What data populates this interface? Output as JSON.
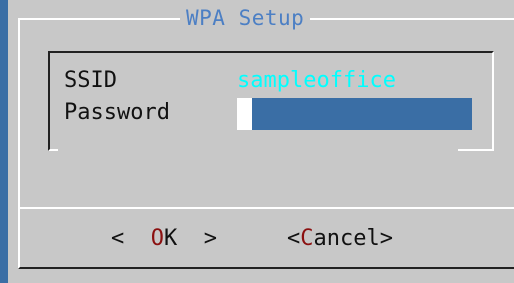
{
  "dialog": {
    "title": "WPA Setup"
  },
  "form": {
    "ssid_label": "SSID",
    "ssid_value": "sampleoffice",
    "password_label": "Password",
    "password_value": ""
  },
  "buttons": {
    "ok": {
      "prefix": "<  ",
      "hotkey": "O",
      "rest": "K  >"
    },
    "cancel": {
      "prefix": "<",
      "hotkey": "C",
      "rest": "ancel>"
    }
  },
  "colors": {
    "background": "#3a6ea5",
    "dialog": "#c8c8c8",
    "title": "#4c7fc4",
    "value_text": "#00ffff",
    "hotkey": "#8b1010"
  }
}
